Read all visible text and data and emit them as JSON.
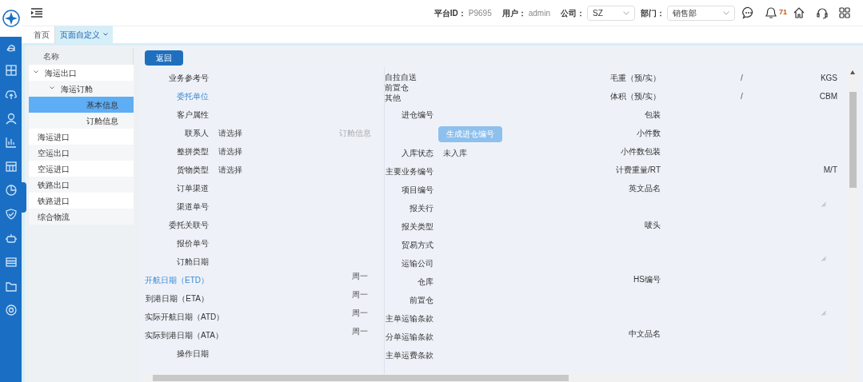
{
  "header": {
    "platform_label": "平台ID：",
    "platform_id": "P9695",
    "user_label": "用户：",
    "user": "admin",
    "company_label": "公司：",
    "company": "SZ",
    "department_label": "部门：",
    "department": "销售部",
    "notification_count": "71"
  },
  "tabs": [
    {
      "label": "首页",
      "selected": false
    },
    {
      "label": "页面自定义",
      "selected": true
    }
  ],
  "tree": {
    "column": "名称",
    "items": [
      {
        "label": "海运出口",
        "expanded": true,
        "selected": false,
        "children": [
          {
            "label": "海运订舱",
            "expanded": true,
            "selected": false,
            "children": [
              {
                "label": "基本信息",
                "selected": true
              },
              {
                "label": "订舱信息",
                "selected": false
              }
            ]
          }
        ]
      },
      {
        "label": "海运进口",
        "selected": false
      },
      {
        "label": "空运出口",
        "selected": false
      },
      {
        "label": "空运进口",
        "selected": false
      },
      {
        "label": "铁路出口",
        "selected": false
      },
      {
        "label": "铁路进口",
        "selected": false
      },
      {
        "label": "综合物流",
        "selected": false
      }
    ]
  },
  "back_button": "返回",
  "columns": [
    [
      {
        "kind": "input",
        "label": "业务参考号",
        "highlighted": false
      },
      {
        "kind": "input",
        "label": "委托单位",
        "highlighted": true
      },
      {
        "kind": "input",
        "label": "客户属性",
        "highlighted": false
      },
      {
        "kind": "select",
        "label": "联系人",
        "value": "请选择",
        "note": "订舱信息",
        "highlighted": false
      },
      {
        "kind": "select",
        "label": "整拼类型",
        "value": "请选择",
        "highlighted": false
      },
      {
        "kind": "select",
        "label": "货物类型",
        "value": "请选择",
        "highlighted": false
      },
      {
        "kind": "input",
        "label": "订单渠道",
        "highlighted": false
      },
      {
        "kind": "input",
        "label": "渠道单号",
        "highlighted": false
      },
      {
        "kind": "input",
        "label": "委托关联号",
        "highlighted": false
      },
      {
        "kind": "input",
        "label": "报价单号",
        "highlighted": false
      },
      {
        "kind": "input",
        "label": "订舱日期",
        "highlighted": false
      },
      {
        "kind": "date",
        "label": "开航日期（ETD）",
        "weekday": "周一",
        "highlighted": true
      },
      {
        "kind": "date",
        "label": "到港日期（ETA）",
        "weekday": "周一",
        "highlighted": false
      },
      {
        "kind": "date",
        "label": "实际开航日期（ATD）",
        "weekday": "周一",
        "highlighted": false
      },
      {
        "kind": "date",
        "label": "实际到港日期（ATA）",
        "weekday": "周一",
        "highlighted": false
      },
      {
        "kind": "input",
        "label": "操作日期",
        "highlighted": false
      }
    ],
    [
      {
        "kind": "options",
        "options": [
          "自拉自送",
          "前置仓",
          "其他"
        ]
      },
      {
        "kind": "input",
        "label": "进仓编号"
      },
      {
        "kind": "button",
        "value": "生成进仓编号"
      },
      {
        "kind": "text",
        "label": "入库状态",
        "value": "未入库"
      },
      {
        "kind": "input",
        "label": "主要业务编号"
      },
      {
        "kind": "input",
        "label": "项目编号"
      },
      {
        "kind": "input",
        "label": "报关行"
      },
      {
        "kind": "input",
        "label": "报关类型"
      },
      {
        "kind": "input",
        "label": "贸易方式"
      },
      {
        "kind": "input",
        "label": "运输公司"
      },
      {
        "kind": "input",
        "label": "仓库"
      },
      {
        "kind": "input",
        "label": "前置仓"
      },
      {
        "kind": "input",
        "label": "主单运输条款"
      },
      {
        "kind": "input",
        "label": "分单运输条款"
      },
      {
        "kind": "input",
        "label": "主单运费条款"
      }
    ],
    [
      {
        "kind": "measure",
        "label": "毛重（预/实）",
        "separator": "/",
        "unit": "KGS"
      },
      {
        "kind": "measure",
        "label": "体积（预/实）",
        "separator": "/",
        "unit": "CBM"
      },
      {
        "kind": "input",
        "label": "包装"
      },
      {
        "kind": "input",
        "label": "小件数"
      },
      {
        "kind": "input",
        "label": "小件数包装"
      },
      {
        "kind": "measure",
        "label": "计费重量/RT",
        "unit": "M/T"
      },
      {
        "kind": "input",
        "label": "英文品名"
      },
      {
        "kind": "textarea",
        "label": "唛头"
      },
      {
        "kind": "textarea",
        "label": "HS编号"
      },
      {
        "kind": "textarea",
        "label": "中文品名"
      }
    ]
  ]
}
